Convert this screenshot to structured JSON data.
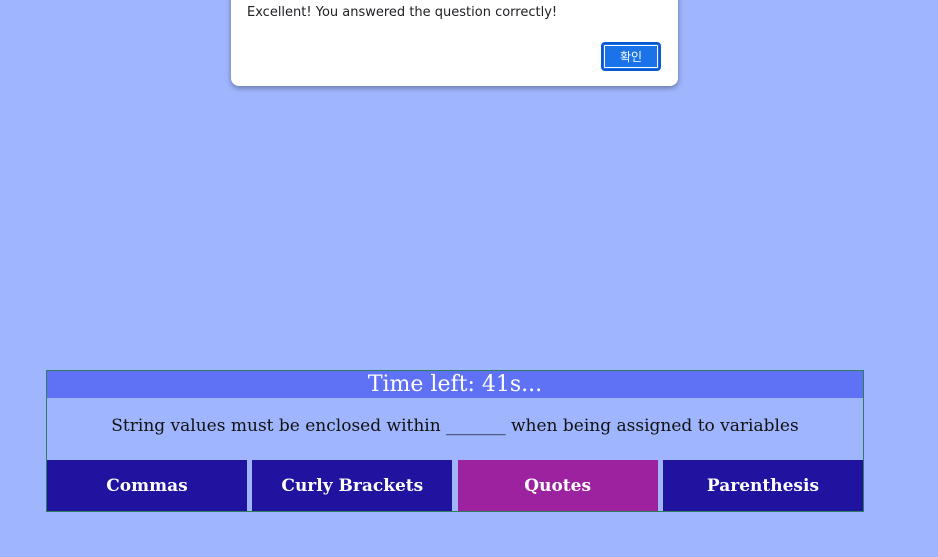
{
  "alert": {
    "message": "Excellent! You answered the question correctly!",
    "ok_label": "확인"
  },
  "quiz": {
    "timer_text": "Time left: 41s...",
    "question": "String values must be enclosed within _______ when being assigned to variables",
    "answers": [
      {
        "label": "Commas",
        "selected": false
      },
      {
        "label": "Curly Brackets",
        "selected": false
      },
      {
        "label": "Quotes",
        "selected": true
      },
      {
        "label": "Parenthesis",
        "selected": false
      }
    ]
  },
  "colors": {
    "page_background": "#9fb5fe",
    "timer_bar": "#5f71f5",
    "answer_button": "#1f13a0",
    "answer_selected": "#9c22a0",
    "alert_button": "#1a73e8"
  }
}
